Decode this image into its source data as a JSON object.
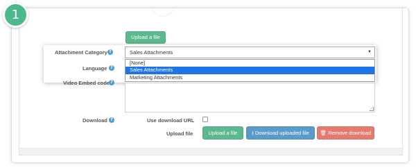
{
  "step": {
    "number": "1",
    "color": "#4cb88c"
  },
  "top_upload_button": {
    "label": "Upload a file"
  },
  "attachment_category": {
    "label": "Attachment Category",
    "selected": "Sales Attachments",
    "options": [
      "[None]",
      "Sales Attachments",
      "Marketing Attachments"
    ],
    "highlighted_index": 1,
    "caret": "▼"
  },
  "language": {
    "label": "Language"
  },
  "video_embed": {
    "label": "Video Embed code"
  },
  "download": {
    "label": "Download",
    "use_download_url_label": "Use download URL",
    "use_download_url_checked": false,
    "upload_file_label": "Upload file",
    "upload_button": "Upload a file",
    "download_uploaded_button": "Download uploaded file",
    "remove_download_button": "Remove download"
  },
  "icons": {
    "help": "question-circle-icon",
    "download": "download-icon",
    "trash": "trash-icon"
  },
  "colors": {
    "green": "#5cb88d",
    "blue": "#5b9bc9",
    "red": "#e57a70",
    "highlight": "#1e74e6",
    "help_icon": "#4a9fd8"
  }
}
